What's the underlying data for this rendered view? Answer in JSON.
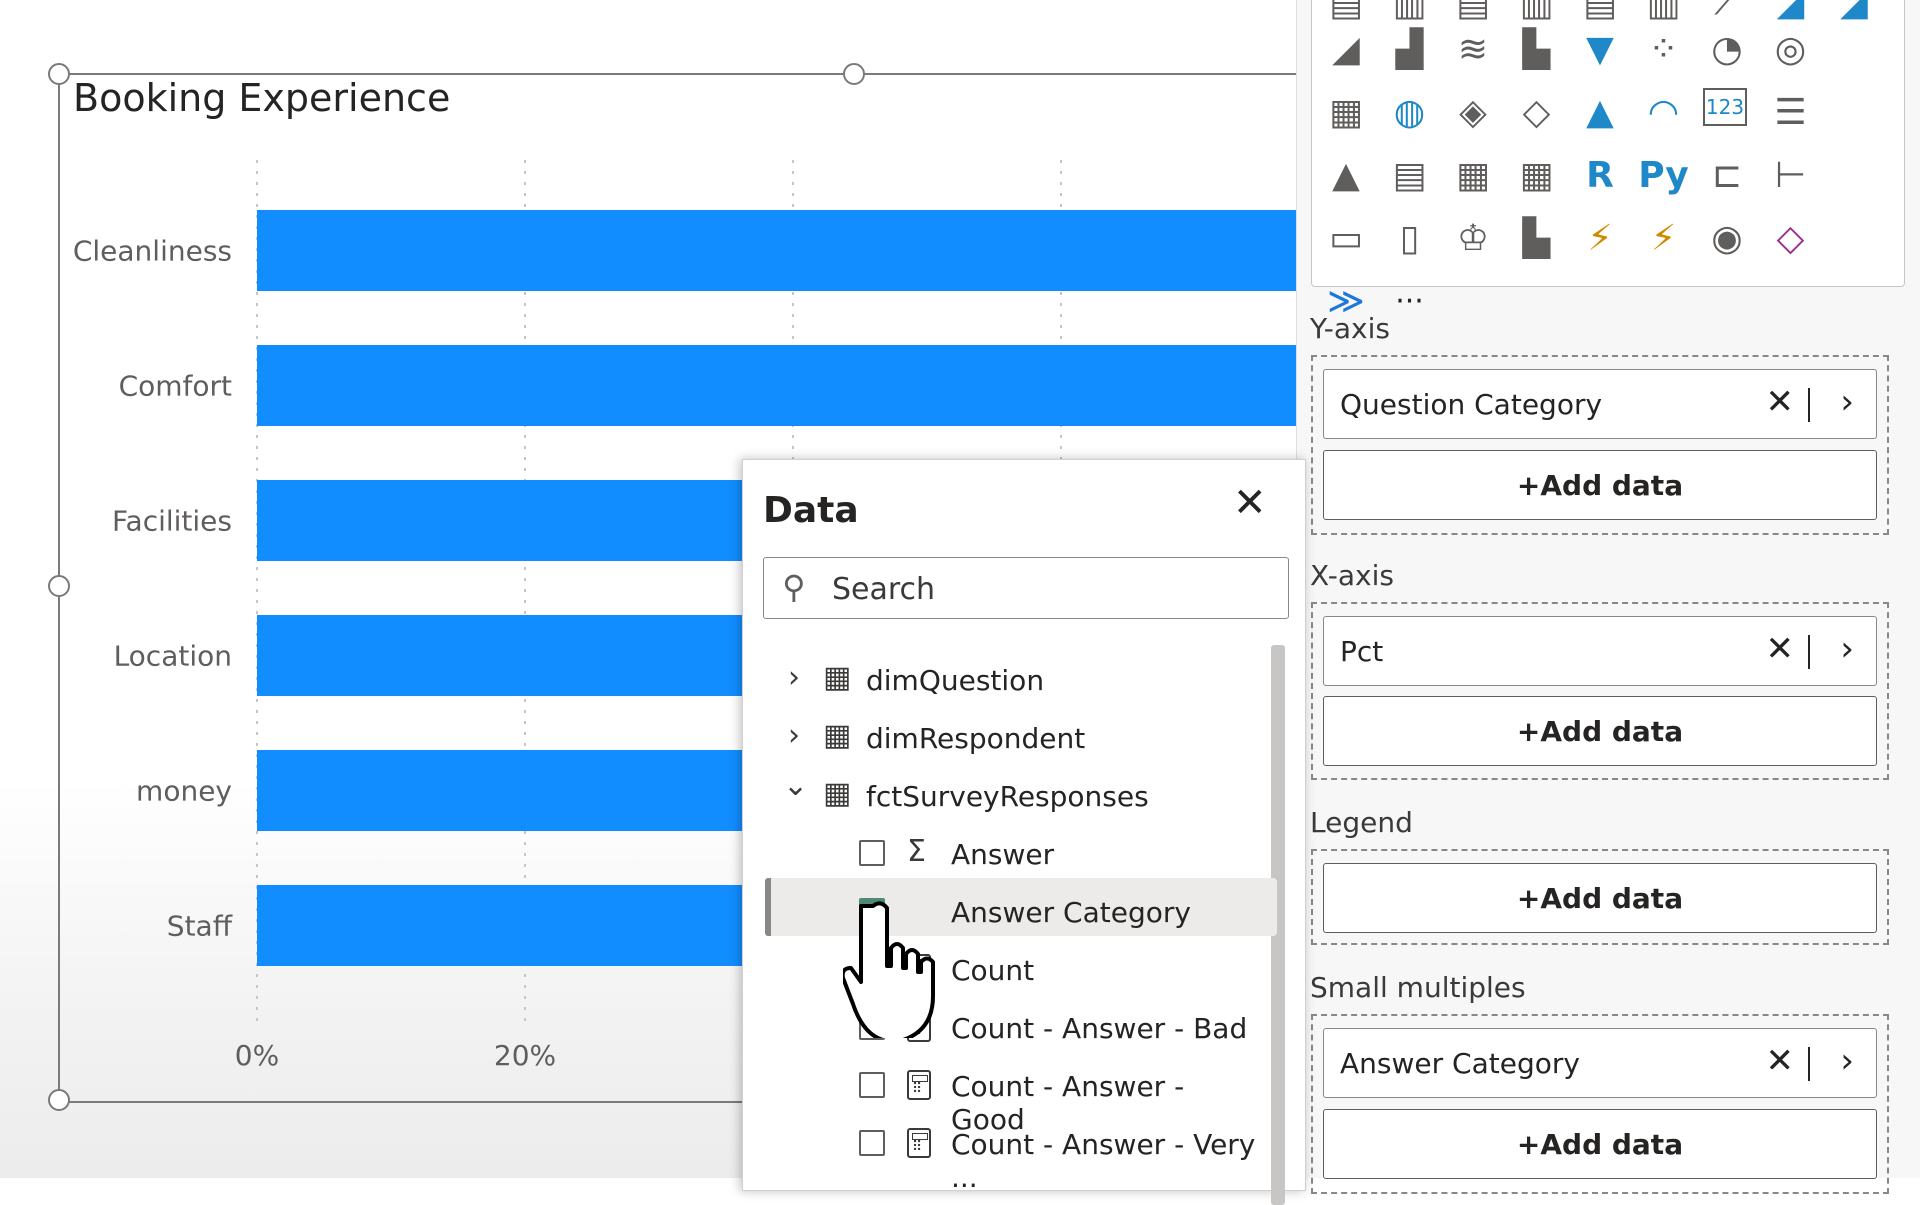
{
  "chart": {
    "title": "Booking Experience"
  },
  "chart_data": {
    "type": "bar",
    "orientation": "horizontal",
    "title": "Booking Experience",
    "categories": [
      "Cleanliness",
      "Comfort",
      "Facilities",
      "Location",
      "money",
      "Staff"
    ],
    "values": [
      100,
      100,
      100,
      100,
      100,
      100
    ],
    "x_ticks": [
      "0%",
      "20%"
    ],
    "xlim": [
      0,
      100
    ],
    "bar_color": "#118DFF",
    "grid": "vertical dotted"
  },
  "viz_pane": {
    "gallery_icons": [
      "stacked-bar-icon",
      "stacked-column-icon",
      "clustered-bar-icon",
      "clustered-column-icon",
      "100-bar-icon",
      "100-column-icon",
      "line-chart-icon",
      "area-chart-icon",
      "stacked-area-icon",
      "line-stacked-column-icon",
      "line-clustered-column-icon",
      "ribbon-chart-icon",
      "waterfall-icon",
      "funnel-icon",
      "scatter-icon",
      "pie-icon",
      "donut-icon",
      "treemap-icon",
      "map-icon",
      "filled-map-icon",
      "shape-map-icon",
      "azure-map-icon",
      "gauge-icon",
      "card-icon",
      "multi-row-card-icon",
      "kpi-icon",
      "slicer-icon",
      "table-icon",
      "matrix-icon",
      "r-visual-icon",
      "python-visual-icon",
      "key-influencers-icon",
      "decomposition-tree-icon",
      "qa-icon",
      "narrative-icon",
      "goals-icon",
      "paginated-report-icon",
      "power-apps-icon",
      "power-automate-icon",
      "arcgis-icon",
      "power-apps-diamond-icon",
      "power-automate-arrow-icon",
      "more-visuals-icon"
    ],
    "r_label": "R",
    "py_label": "Py",
    "card_label": "123",
    "more_label": "···",
    "y_axis": {
      "label": "Y-axis",
      "field": "Question Category",
      "add": "+Add data"
    },
    "x_axis": {
      "label": "X-axis",
      "field": "Pct",
      "add": "+Add data"
    },
    "legend": {
      "label": "Legend",
      "add": "+Add data"
    },
    "small_multiples": {
      "label": "Small multiples",
      "field": "Answer Category",
      "add": "+Add data"
    },
    "remove_glyph": "✕",
    "chevron_glyph": "›"
  },
  "data_pane": {
    "title": "Data",
    "close": "✕",
    "search_placeholder": "Search",
    "tables": [
      {
        "name": "dimQuestion",
        "expanded": false
      },
      {
        "name": "dimRespondent",
        "expanded": false
      },
      {
        "name": "fctSurveyResponses",
        "expanded": true
      }
    ],
    "fields": [
      {
        "name": "Answer",
        "checked": false,
        "icon": "sigma"
      },
      {
        "name": "Answer Category",
        "checked": true,
        "icon": "none"
      },
      {
        "name": "Count",
        "checked": false,
        "icon": "calculator"
      },
      {
        "name": "Count - Answer - Bad",
        "checked": false,
        "icon": "calculator"
      },
      {
        "name": "Count - Answer - Good",
        "checked": false,
        "icon": "calculator"
      },
      {
        "name": "Count - Answer - Very ...",
        "checked": false,
        "icon": "calculator"
      }
    ],
    "collapsed_glyph": "›",
    "expanded_glyph": "⌄",
    "table_glyph": "▦",
    "sigma_glyph": "Σ"
  },
  "colors": {
    "accent": "#118DFF",
    "check": "#4f8a78"
  }
}
